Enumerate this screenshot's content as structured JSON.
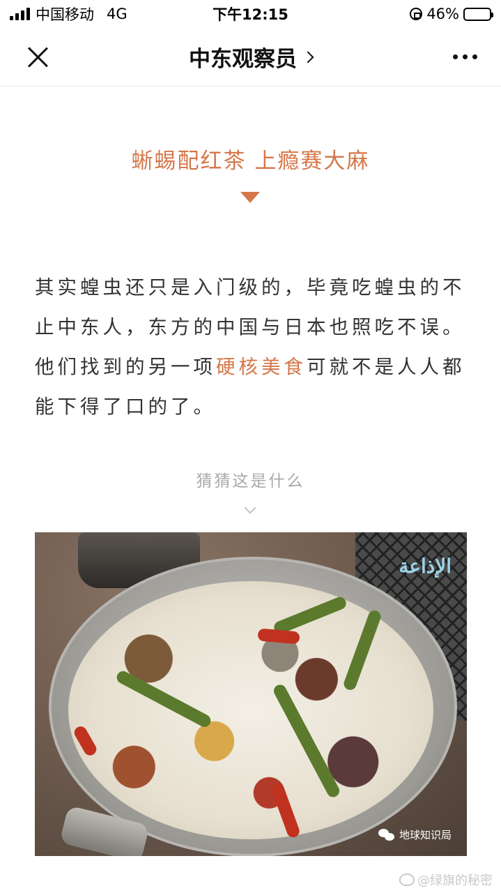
{
  "status_bar": {
    "carrier": "中国移动",
    "network": "4G",
    "time": "下午12:15",
    "battery_percent_label": "46%",
    "battery_level": 0.46
  },
  "nav": {
    "title": "中东观察员",
    "icons": [
      "close-icon",
      "chevron-right-icon",
      "more-icon"
    ]
  },
  "article": {
    "heading": "蜥蜴配红茶 上瘾赛大麻",
    "paragraph_before": "其实蝗虫还只是入门级的，毕竟吃蝗虫的不止中东人，东方的中国与日本也照吃不误。他们找到的另一项",
    "paragraph_highlight": "硬核美食",
    "paragraph_after": "可就不是人人都能下得了口的了。",
    "caption": "猜猜这是什么",
    "accent_color": "#d4774a"
  },
  "photo": {
    "overlay_text": "الإذاعة",
    "credit": "地球知识局"
  },
  "watermark": {
    "text": "@绿旗的秘密"
  }
}
